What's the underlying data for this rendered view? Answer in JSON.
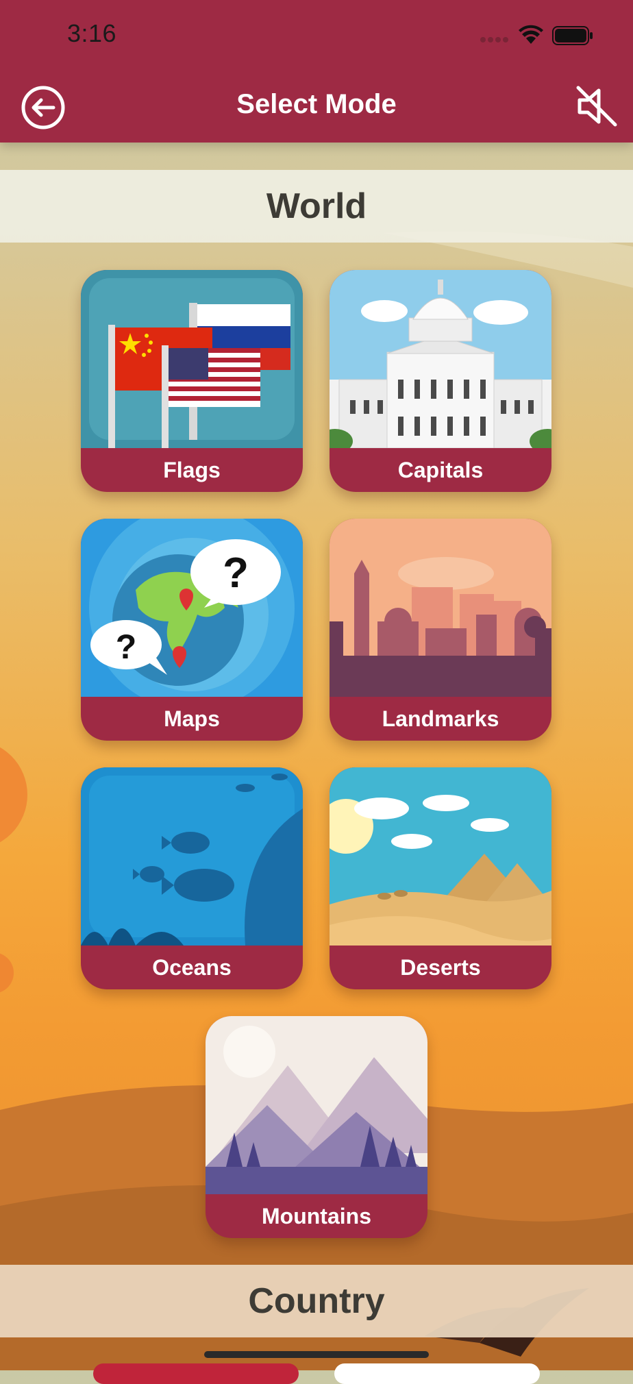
{
  "status_bar": {
    "time": "3:16"
  },
  "header": {
    "title": "Select Mode",
    "back_icon": "arrow-left-circle-icon",
    "mute_icon": "speaker-muted-icon"
  },
  "sections": {
    "world": {
      "title": "World",
      "items": [
        {
          "label": "Flags",
          "icon": "flags-image"
        },
        {
          "label": "Capitals",
          "icon": "capitol-building-image"
        },
        {
          "label": "Maps",
          "icon": "globe-question-image"
        },
        {
          "label": "Landmarks",
          "icon": "city-skyline-image"
        },
        {
          "label": "Oceans",
          "icon": "underwater-fish-image"
        },
        {
          "label": "Deserts",
          "icon": "pyramids-desert-image"
        },
        {
          "label": "Mountains",
          "icon": "mountains-image"
        }
      ]
    },
    "country": {
      "title": "Country"
    }
  },
  "colors": {
    "brand": "#9e2a44",
    "band_text": "#3d3b35"
  }
}
